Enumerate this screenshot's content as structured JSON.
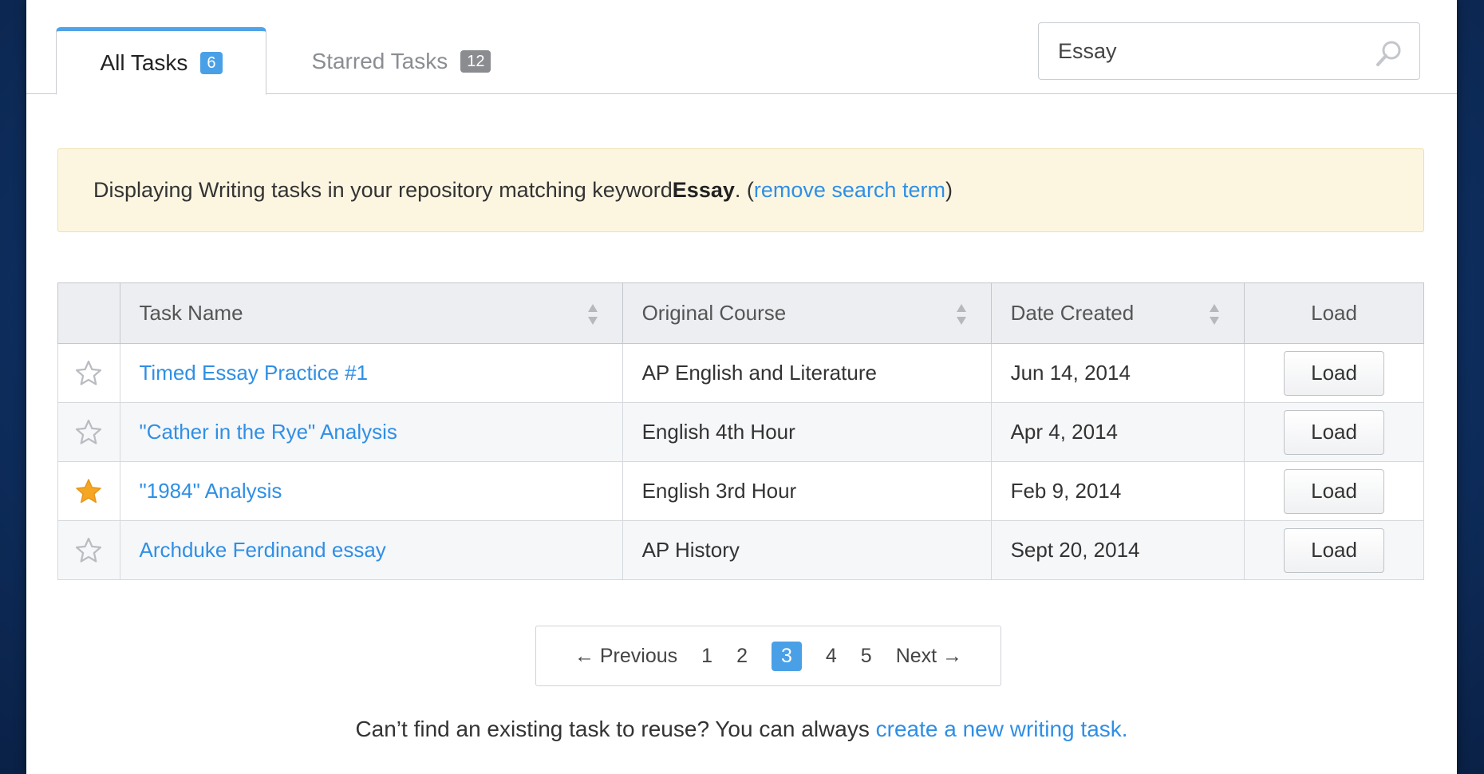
{
  "tabs": [
    {
      "label": "All Tasks",
      "count": "6"
    },
    {
      "label": "Starred Tasks",
      "count": "12"
    }
  ],
  "search": {
    "value": "Essay"
  },
  "notice": {
    "prefix": "Displaying Writing tasks in your repository matching keyword ",
    "keyword": "Essay",
    "middle": ". (",
    "link": "remove search term",
    "suffix": ")"
  },
  "table": {
    "headers": [
      "Task Name",
      "Original Course",
      "Date Created",
      "Load"
    ],
    "rows": [
      {
        "starred": false,
        "name": "Timed Essay Practice #1",
        "course": "AP English and Literature",
        "date": "Jun 14, 2014",
        "button": "Load"
      },
      {
        "starred": false,
        "name": "\"Cather in the Rye\" Analysis",
        "course": "English 4th Hour",
        "date": "Apr 4, 2014",
        "button": "Load"
      },
      {
        "starred": true,
        "name": "\"1984\" Analysis",
        "course": "English 3rd Hour",
        "date": "Feb 9, 2014",
        "button": "Load"
      },
      {
        "starred": false,
        "name": "Archduke Ferdinand essay",
        "course": "AP History",
        "date": "Sept 20, 2014",
        "button": "Load"
      }
    ]
  },
  "pagination": {
    "previous": "← Previous",
    "pages": [
      "1",
      "2",
      "3",
      "4",
      "5"
    ],
    "current": "3",
    "next": "Next →"
  },
  "footer": {
    "text": "Can’t find an existing task to reuse? You can always ",
    "link": "create a new writing task."
  },
  "colors": {
    "accent": "#4aa0e6",
    "link": "#2f8fe5",
    "star_filled": "#f5a623",
    "notice_bg": "#fcf6e1"
  }
}
